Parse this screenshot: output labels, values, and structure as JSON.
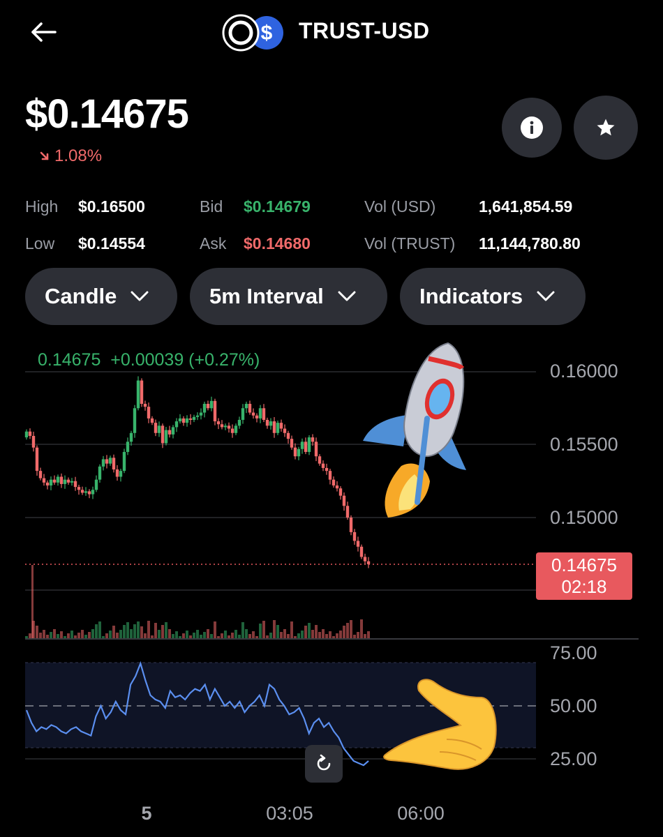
{
  "header": {
    "title": "TRUST-USD"
  },
  "price": {
    "value": "$0.14675",
    "change": "1.08%"
  },
  "stats": {
    "high_label": "High",
    "high_value": "$0.16500",
    "low_label": "Low",
    "low_value": "$0.14554",
    "bid_label": "Bid",
    "bid_value": "$0.14679",
    "ask_label": "Ask",
    "ask_value": "$0.14680",
    "vol_usd_label": "Vol (USD)",
    "vol_usd_value": "1,641,854.59",
    "vol_trust_label": "Vol (TRUST)",
    "vol_trust_value": "11,144,780.80"
  },
  "controls": {
    "chart_type": "Candle",
    "interval": "5m Interval",
    "indicators": "Indicators"
  },
  "chart": {
    "legend": "0.14675  +0.00039 (+0.27%)",
    "price_ticks": [
      "0.16000",
      "0.15500",
      "0.15000"
    ],
    "current_price": "0.14675",
    "countdown": "02:18",
    "rsi_ticks": [
      "75.00",
      "50.00",
      "25.00"
    ],
    "time_ticks": [
      "5",
      "03:05",
      "06:00"
    ]
  },
  "colors": {
    "up": "#38b36b",
    "down": "#f06a6a",
    "rsi": "#5b8ff0",
    "pill": "#2d2f36"
  },
  "icons": {
    "back": "arrow-left-icon",
    "info": "info-icon",
    "star": "star-icon",
    "reset": "reset-icon",
    "chevron": "chevron-down-icon"
  },
  "chart_data": {
    "type": "candlestick",
    "ylim": [
      0.1455,
      0.1625
    ],
    "closes": [
      0.1559,
      0.1556,
      0.1548,
      0.1532,
      0.1527,
      0.1524,
      0.1522,
      0.1526,
      0.1524,
      0.1528,
      0.1523,
      0.1526,
      0.1524,
      0.1525,
      0.1521,
      0.1519,
      0.1517,
      0.1518,
      0.1516,
      0.1519,
      0.1526,
      0.1535,
      0.154,
      0.1537,
      0.1541,
      0.1533,
      0.1528,
      0.1532,
      0.1545,
      0.1552,
      0.1558,
      0.1575,
      0.1594,
      0.1578,
      0.1576,
      0.1568,
      0.1565,
      0.1558,
      0.1563,
      0.1551,
      0.156,
      0.1557,
      0.1562,
      0.1566,
      0.1568,
      0.1565,
      0.1568,
      0.1567,
      0.1569,
      0.157,
      0.1572,
      0.1578,
      0.1575,
      0.158,
      0.1566,
      0.1564,
      0.1562,
      0.1563,
      0.1561,
      0.1558,
      0.1563,
      0.1567,
      0.1575,
      0.1578,
      0.1572,
      0.157,
      0.1568,
      0.1575,
      0.1567,
      0.1563,
      0.1566,
      0.1558,
      0.1565,
      0.1561,
      0.1558,
      0.1554,
      0.1548,
      0.1542,
      0.1547,
      0.1552,
      0.1545,
      0.1555,
      0.1552,
      0.1542,
      0.1537,
      0.1534,
      0.1532,
      0.1526,
      0.1522,
      0.152,
      0.1515,
      0.1508,
      0.15,
      0.149,
      0.1484,
      0.148,
      0.1473,
      0.147,
      0.1468
    ],
    "rsi": [
      48,
      42,
      38,
      40,
      39,
      41,
      40,
      38,
      37,
      39,
      40,
      38,
      37,
      36,
      45,
      50,
      44,
      47,
      52,
      48,
      46,
      60,
      64,
      70,
      62,
      55,
      53,
      52,
      49,
      57,
      54,
      55,
      53,
      56,
      58,
      57,
      60,
      53,
      58,
      54,
      50,
      52,
      49,
      52,
      47,
      50,
      52,
      55,
      50,
      60,
      58,
      53,
      50,
      46,
      47,
      49,
      44,
      37,
      42,
      44,
      40,
      42,
      38,
      35,
      30,
      27,
      24,
      23,
      22,
      24
    ]
  }
}
